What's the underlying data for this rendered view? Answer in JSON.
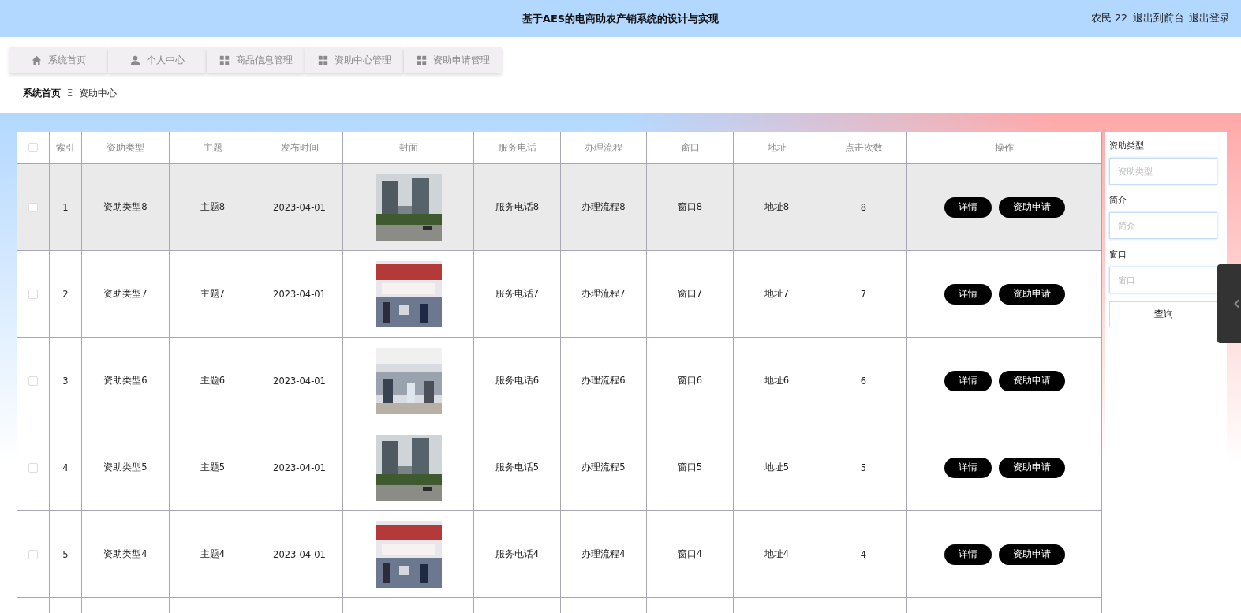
{
  "header": {
    "title": "基于AES的电商助农产销系统的设计与实现",
    "user": "农民 22",
    "links": [
      "退出到前台",
      "退出登录"
    ]
  },
  "nav": [
    {
      "label": "系统首页",
      "kind": "home",
      "selected": false
    },
    {
      "label": "个人中心",
      "kind": "profile",
      "selected": false
    },
    {
      "label": "商品信息管理",
      "kind": "module",
      "selected": false
    },
    {
      "label": "资助中心管理",
      "kind": "module",
      "selected": false
    },
    {
      "label": "资助申请管理",
      "kind": "module",
      "selected": false
    }
  ],
  "breadcrumb": {
    "items": [
      "系统首页",
      "资助中心"
    ],
    "separator": "Ξ"
  },
  "table": {
    "all_checked": false,
    "columns": [
      "索引",
      "资助类型",
      "主题",
      "发布时间",
      "封面",
      "服务电话",
      "办理流程",
      "窗口",
      "地址",
      "点击次数",
      "操作"
    ],
    "rows": [
      {
        "index": "1",
        "type": "资助类型8",
        "topic": "主题8",
        "date": "2023-04-01",
        "phone": "服务电话8",
        "process": "办理流程8",
        "window": "窗口8",
        "address": "地址8",
        "clicks": "8",
        "checked": false,
        "hovered": true,
        "actions": [
          "详情",
          "资助申请"
        ]
      },
      {
        "index": "2",
        "type": "资助类型7",
        "topic": "主题7",
        "date": "2023-04-01",
        "phone": "服务电话7",
        "process": "办理流程7",
        "window": "窗口7",
        "address": "地址7",
        "clicks": "7",
        "checked": false,
        "hovered": false,
        "actions": [
          "详情",
          "资助申请"
        ]
      },
      {
        "index": "3",
        "type": "资助类型6",
        "topic": "主题6",
        "date": "2023-04-01",
        "phone": "服务电话6",
        "process": "办理流程6",
        "window": "窗口6",
        "address": "地址6",
        "clicks": "6",
        "checked": false,
        "hovered": false,
        "actions": [
          "详情",
          "资助申请"
        ]
      },
      {
        "index": "4",
        "type": "资助类型5",
        "topic": "主题5",
        "date": "2023-04-01",
        "phone": "服务电话5",
        "process": "办理流程5",
        "window": "窗口5",
        "address": "地址5",
        "clicks": "5",
        "checked": false,
        "hovered": false,
        "actions": [
          "详情",
          "资助申请"
        ]
      },
      {
        "index": "5",
        "type": "资助类型4",
        "topic": "主题4",
        "date": "2023-04-01",
        "phone": "服务电话4",
        "process": "办理流程4",
        "window": "窗口4",
        "address": "地址4",
        "clicks": "4",
        "checked": false,
        "hovered": false,
        "actions": [
          "详情",
          "资助申请"
        ]
      }
    ]
  },
  "search": {
    "fields": [
      {
        "label": "资助类型",
        "placeholder": "资助类型"
      },
      {
        "label": "简介",
        "placeholder": "简介"
      },
      {
        "label": "窗口",
        "placeholder": "窗口"
      }
    ],
    "button": "查询"
  }
}
